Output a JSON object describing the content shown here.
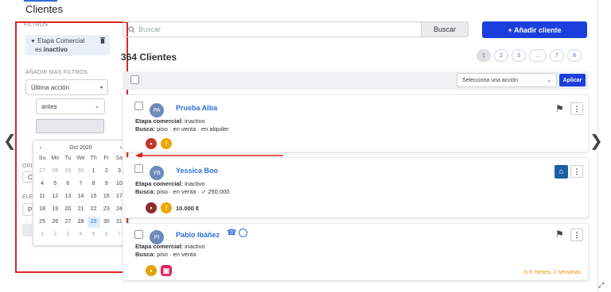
{
  "page": {
    "title": "Clientes"
  },
  "sidebar": {
    "filters_heading": "FILTROS",
    "filter_chip": {
      "line1": "Etapa Comercial",
      "line2_prefix": "es ",
      "line2_value": "inactivo"
    },
    "add_filters_heading": "AÑADIR MÁS FILTROS",
    "last_action_select": "Última acción",
    "before_select": "antes",
    "under_calendar_labels": [
      "ORI",
      "C",
      "ELE",
      "P"
    ]
  },
  "calendar": {
    "month_label": "Oct 2020",
    "prev": "‹",
    "next": "›",
    "weekdays": [
      "Su",
      "Mo",
      "Tu",
      "We",
      "Th",
      "Fr",
      "Sa"
    ],
    "days": [
      {
        "d": "27",
        "dim": true
      },
      {
        "d": "28",
        "dim": true
      },
      {
        "d": "29",
        "dim": true
      },
      {
        "d": "30",
        "dim": true
      },
      {
        "d": "1"
      },
      {
        "d": "2"
      },
      {
        "d": "3"
      },
      {
        "d": "4"
      },
      {
        "d": "5"
      },
      {
        "d": "6"
      },
      {
        "d": "7"
      },
      {
        "d": "8"
      },
      {
        "d": "9"
      },
      {
        "d": "10"
      },
      {
        "d": "11"
      },
      {
        "d": "12"
      },
      {
        "d": "13"
      },
      {
        "d": "14"
      },
      {
        "d": "15"
      },
      {
        "d": "16"
      },
      {
        "d": "17"
      },
      {
        "d": "18"
      },
      {
        "d": "19"
      },
      {
        "d": "20"
      },
      {
        "d": "21"
      },
      {
        "d": "22"
      },
      {
        "d": "23"
      },
      {
        "d": "24"
      },
      {
        "d": "25"
      },
      {
        "d": "26"
      },
      {
        "d": "27"
      },
      {
        "d": "28"
      },
      {
        "d": "29",
        "today": true
      },
      {
        "d": "30"
      },
      {
        "d": "31"
      },
      {
        "d": "1",
        "dim": true
      },
      {
        "d": "2",
        "dim": true
      },
      {
        "d": "3",
        "dim": true
      },
      {
        "d": "4",
        "dim": true
      },
      {
        "d": "5",
        "dim": true
      },
      {
        "d": "6",
        "dim": true
      },
      {
        "d": "7",
        "dim": true
      }
    ]
  },
  "search": {
    "placeholder": "Buscar",
    "button": "Buscar"
  },
  "add_client_button": "+ Añadir cliente",
  "clients_count": "364 Clientes",
  "pagination": [
    "1",
    "2",
    "3",
    "...",
    "7",
    "8"
  ],
  "bulk_actions": {
    "select_placeholder": "Selecciona una acción",
    "apply": "Aplicar"
  },
  "clients": [
    {
      "initials": "PA",
      "name": "Prueba Alba",
      "stage_label": "Etapa comercial:",
      "stage_value": "inactivo",
      "search_label": "Busca:",
      "search_value": "piso · en venta · en alquiler"
    },
    {
      "initials": "YB",
      "name": "Yessica Boo",
      "stage_label": "Etapa comercial:",
      "stage_value": "inactivo",
      "search_label": "Busca:",
      "search_value": "piso · en venta · ✓ 250.000",
      "price": "10.000 €"
    },
    {
      "initials": "PI",
      "name": "Pablo Ibáñez",
      "stage_label": "Etapa comercial:",
      "stage_value": "inactivo",
      "search_label": "Busca:",
      "search_value": "piso · en venta",
      "time_badge": "5 meses, 2 semanas"
    }
  ],
  "colors": {
    "primary": "#1a3fdc",
    "link": "#2f6fd6",
    "annotation": "#e02424",
    "warning": "#f0a500"
  }
}
